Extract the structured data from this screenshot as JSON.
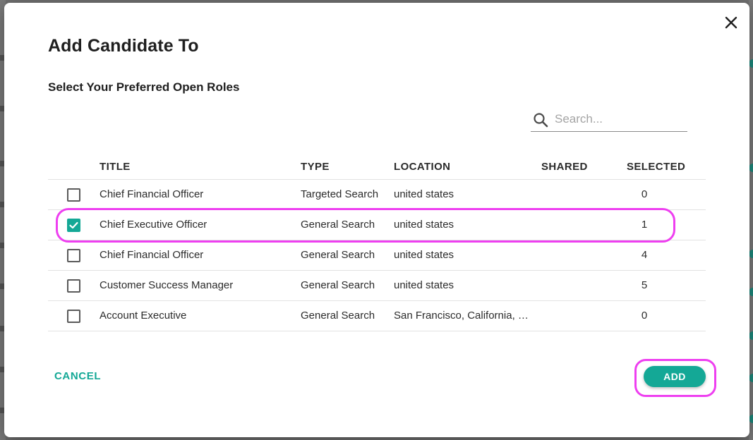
{
  "dialog": {
    "title": "Add Candidate To",
    "subtitle": "Select Your Preferred Open Roles",
    "search": {
      "placeholder": "Search...",
      "value": ""
    },
    "close_icon": "close-icon"
  },
  "table": {
    "headers": {
      "title": "TITLE",
      "type": "TYPE",
      "location": "LOCATION",
      "shared": "SHARED",
      "selected": "SELECTED"
    },
    "rows": [
      {
        "checked": false,
        "title": "Chief Financial Officer",
        "type": "Targeted Search",
        "location": "united states",
        "shared": "",
        "selected": "0"
      },
      {
        "checked": true,
        "title": "Chief Executive Officer",
        "type": "General Search",
        "location": "united states",
        "shared": "",
        "selected": "1"
      },
      {
        "checked": false,
        "title": "Chief Financial Officer",
        "type": "General Search",
        "location": "united states",
        "shared": "",
        "selected": "4"
      },
      {
        "checked": false,
        "title": "Customer Success Manager",
        "type": "General Search",
        "location": "united states",
        "shared": "",
        "selected": "5"
      },
      {
        "checked": false,
        "title": "Account Executive",
        "type": "General Search",
        "location": "San Francisco, California, …",
        "shared": "",
        "selected": "0"
      }
    ]
  },
  "actions": {
    "cancel_label": "CANCEL",
    "add_label": "ADD"
  },
  "colors": {
    "accent": "#14a896",
    "highlight": "#ee3ff0"
  }
}
